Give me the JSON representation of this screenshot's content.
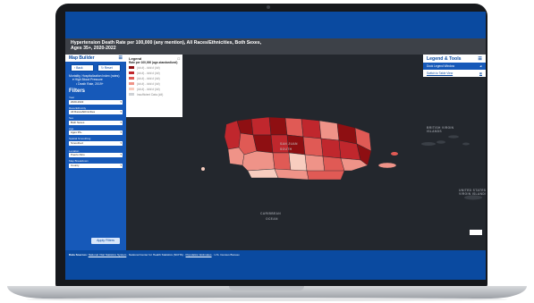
{
  "title": {
    "line1": "Hypertension Death Rate per 100,000 (any mention), All Races/Ethnicities, Both Sexes,",
    "line2": "Ages 35+, 2020-2022"
  },
  "sidebar": {
    "header": "Map Builder",
    "back_label": "Back",
    "reset_label": "Reset",
    "tree": [
      "Mortality, Hospitalization Index (rates)",
      "High Blood Pressure",
      "Death Rate, 2019+"
    ],
    "filters_title": "Filters",
    "fields": [
      {
        "label": "Year",
        "value": "2020-2022"
      },
      {
        "label": "Race/Ethnicity",
        "value": "All Races/Ethnicities"
      },
      {
        "label": "Sex",
        "value": "Both Sexes"
      },
      {
        "label": "Age",
        "value": "Ages 35+"
      },
      {
        "label": "Spatial Smoothing",
        "value": "Smoothed"
      },
      {
        "label": "Location",
        "value": "Puerto Rico"
      },
      {
        "label": "Map Breakdown",
        "value": "County"
      }
    ],
    "apply_label": "Apply Filters"
  },
  "legend": {
    "title": "Legend",
    "subtitle": "Rate per 100,000 (age-standardized)",
    "items": [
      {
        "label": "(##.#) - ###.# (##)",
        "color": "#8e0f12"
      },
      {
        "label": "(##.#) - ###.# (##)",
        "color": "#c0272d"
      },
      {
        "label": "(##.#) - ###.# (##)",
        "color": "#e05a55"
      },
      {
        "label": "(##.#) - ###.# (##)",
        "color": "#ef9388"
      },
      {
        "label": "(##.#) - ###.# (##)",
        "color": "#f8cdbf"
      },
      {
        "label": "Insufficient Data (##)",
        "color": "#cfd2d6"
      }
    ]
  },
  "tools": {
    "header": "Legend & Tools",
    "dock_label": "Dock Legend Window",
    "table_label": "Switch to Table View"
  },
  "map_labels": [
    "SOUTH",
    "OCEAN",
    "SAN JUAN",
    "CARIBBEAN",
    "BRITISH VIRGIN ISLANDS",
    "UNITED STATES VIRGIN ISLANDS"
  ],
  "footer": {
    "prefix": "Data Sources:",
    "src1": "National Vital Statistics System",
    "src2": "National Center for Health Statistics (NCHS)",
    "src3": "Population Estimates",
    "src4": "U.S. Census Bureau"
  },
  "icons": [
    "menu-icon",
    "back-arrow-icon",
    "reset-icon",
    "expand-icon",
    "chevron-down-icon",
    "dock-icon"
  ]
}
